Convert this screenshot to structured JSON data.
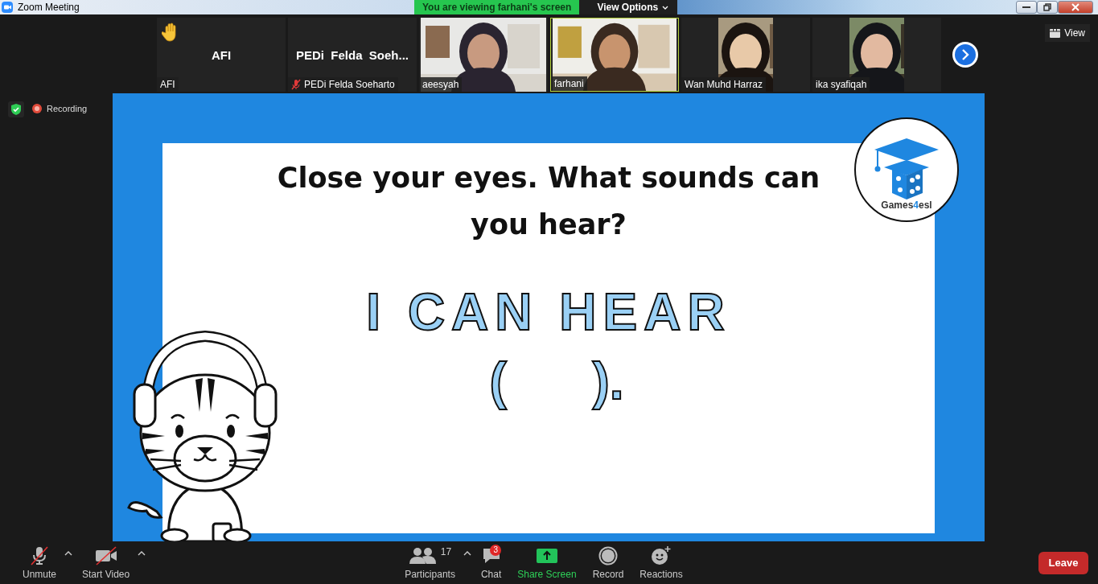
{
  "window": {
    "title": "Zoom Meeting"
  },
  "share_banner": {
    "text": "You are viewing farhani's screen",
    "view_options": "View Options"
  },
  "gallery": {
    "tiles": [
      {
        "kind": "name",
        "display_name": "AFI",
        "label": "AFI",
        "raised_hand": true,
        "muted": false,
        "active_speaker": false
      },
      {
        "kind": "name",
        "display_name": "PEDi  Felda  Soeh...",
        "label": "PEDi Felda Soeharto",
        "raised_hand": false,
        "muted": true,
        "active_speaker": false
      },
      {
        "kind": "video-wide",
        "label": "aeesyah",
        "raised_hand": false,
        "muted": false,
        "active_speaker": false
      },
      {
        "kind": "video-wide",
        "label": "farhani",
        "raised_hand": false,
        "muted": false,
        "active_speaker": true
      },
      {
        "kind": "video-narrow",
        "label": "Wan Muhd Harraz",
        "raised_hand": false,
        "muted": false,
        "active_speaker": false
      },
      {
        "kind": "video-narrow",
        "label": "ika syafiqah",
        "raised_hand": false,
        "muted": false,
        "active_speaker": false
      }
    ],
    "view_button": "View"
  },
  "recording": {
    "label": "Recording"
  },
  "slide": {
    "title": "Close your eyes. What sounds can you hear?",
    "phrase": "I CAN HEAR",
    "blank": "(      ).",
    "logo_parts": [
      {
        "text": "Games",
        "accent": false
      },
      {
        "text": "4",
        "accent": true
      },
      {
        "text": "esl",
        "accent": false
      }
    ]
  },
  "toolbar": {
    "left": [
      {
        "kind": "audio",
        "label": "Unmute",
        "caret": true
      },
      {
        "kind": "video",
        "label": "Start Video",
        "caret": true
      }
    ],
    "center": [
      {
        "kind": "participants",
        "label": "Participants",
        "count": "17",
        "caret": true,
        "highlighted": false
      },
      {
        "kind": "chat",
        "label": "Chat",
        "badge": "3",
        "caret": false,
        "highlighted": false
      },
      {
        "kind": "share",
        "label": "Share Screen",
        "caret": false,
        "highlighted": true
      },
      {
        "kind": "record",
        "label": "Record",
        "caret": false,
        "highlighted": false
      },
      {
        "kind": "reactions",
        "label": "Reactions",
        "caret": false,
        "highlighted": false
      }
    ],
    "leave": "Leave"
  }
}
